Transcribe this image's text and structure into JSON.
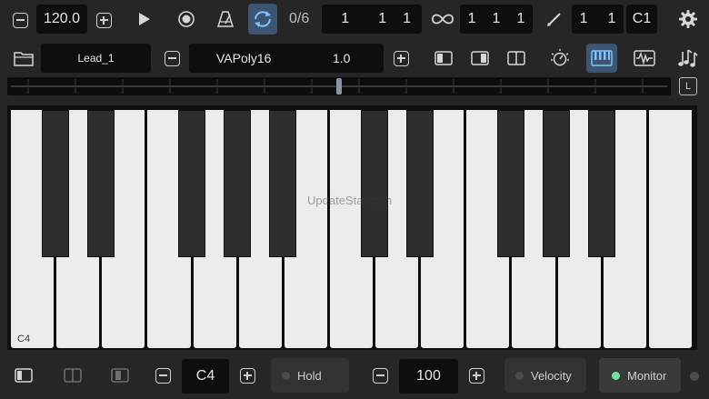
{
  "transport": {
    "tempo": "120.0",
    "count": "0/6",
    "position": [
      "1",
      "1",
      "1"
    ],
    "loop": [
      "1",
      "1",
      "1"
    ],
    "punch": [
      "1",
      "1"
    ],
    "punch_note": "C1"
  },
  "track": {
    "name": "Lead_1",
    "instrument": "VAPoly16",
    "instrument_value": "1.0"
  },
  "slider": {
    "button_label": "L",
    "position_pct": 50
  },
  "keyboard": {
    "start_note_label": "C4",
    "white_key_count": 15,
    "black_key_offsets": [
      0,
      1,
      3,
      4,
      5,
      7,
      8,
      10,
      11,
      12
    ],
    "watermark": "UpdateStar.com"
  },
  "bottom": {
    "octave": "C4",
    "hold_label": "Hold",
    "velocity_value": "100",
    "velocity_label": "Velocity",
    "monitor_label": "Monitor"
  },
  "colors": {
    "accent": "#3d5573",
    "monitor_on": "#6fe0a0"
  }
}
